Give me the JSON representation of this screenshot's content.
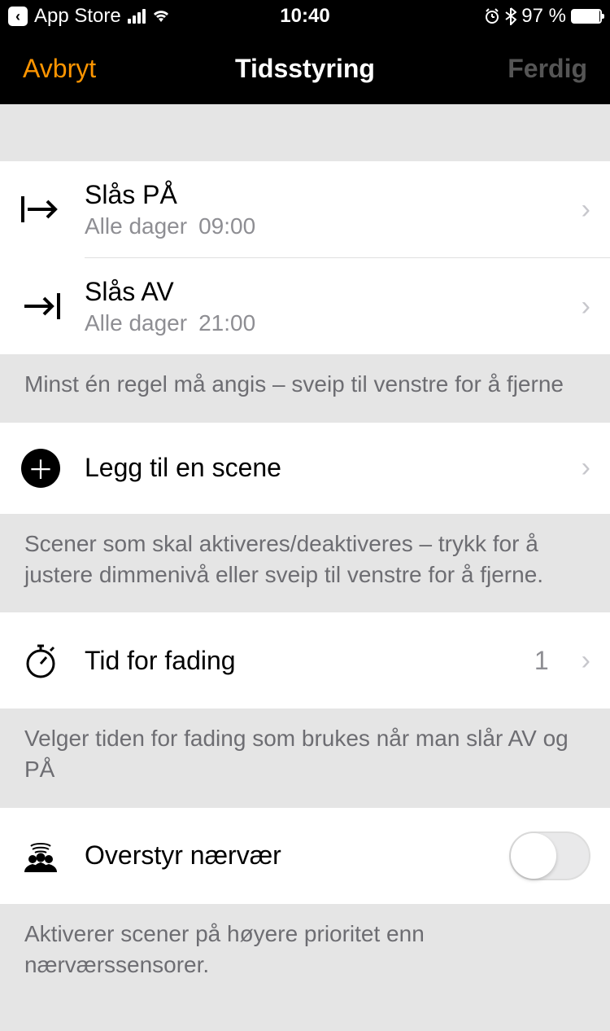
{
  "status": {
    "back_label": "App Store",
    "time": "10:40",
    "battery_pct": "97 %"
  },
  "nav": {
    "cancel": "Avbryt",
    "title": "Tidsstyring",
    "done": "Ferdig"
  },
  "rules": [
    {
      "title": "Slås PÅ",
      "days": "Alle dager",
      "time": "09:00"
    },
    {
      "title": "Slås AV",
      "days": "Alle dager",
      "time": "21:00"
    }
  ],
  "rules_footer": "Minst én regel må angis – sveip til venstre for å fjerne",
  "add_scene": {
    "label": "Legg til en scene"
  },
  "scenes_footer": "Scener som skal aktiveres/deaktiveres – trykk for å justere dimmenivå eller sveip til venstre for å fjerne.",
  "fade": {
    "label": "Tid for fading",
    "value": "1"
  },
  "fade_footer": "Velger tiden for fading som brukes når man slår AV og PÅ",
  "presence": {
    "label": "Overstyr nærvær",
    "on": false
  },
  "presence_footer": "Aktiverer scener på høyere prioritet enn nærværssensorer."
}
